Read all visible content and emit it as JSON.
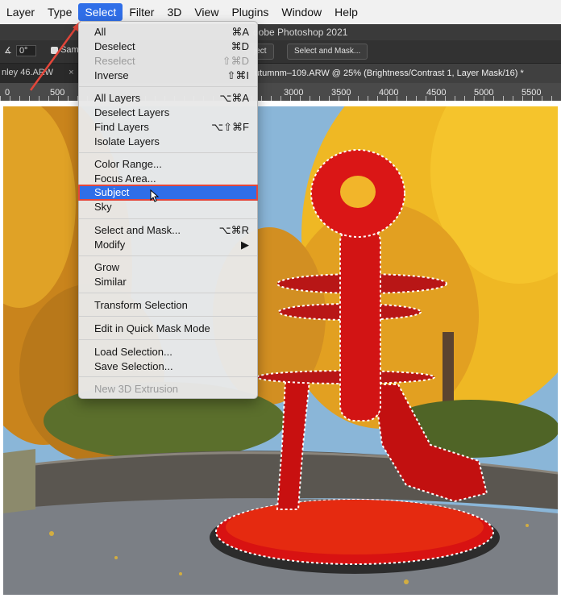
{
  "menubar": {
    "items": [
      "Layer",
      "Type",
      "Select",
      "Filter",
      "3D",
      "View",
      "Plugins",
      "Window",
      "Help"
    ],
    "active_item": "Select"
  },
  "window": {
    "title": "dobe Photoshop 2021"
  },
  "options_bar": {
    "angle_value": "0°",
    "sample_label": "Sam",
    "subject_button": "ject",
    "select_and_mask_button": "Select and Mask..."
  },
  "tabs": {
    "tab1": "nley 46.ARW",
    "tab1_close": "×",
    "tab2": "utumnm–109.ARW @ 25% (Brightness/Contrast 1, Layer Mask/16) *"
  },
  "ruler": {
    "labels": [
      "0",
      "500",
      "3000",
      "3500",
      "4000",
      "4500",
      "5000",
      "5500"
    ]
  },
  "select_menu": {
    "items": [
      {
        "label": "All",
        "shortcut": "⌘A"
      },
      {
        "label": "Deselect",
        "shortcut": "⌘D"
      },
      {
        "label": "Reselect",
        "shortcut": "⇧⌘D",
        "disabled": true
      },
      {
        "label": "Inverse",
        "shortcut": "⇧⌘I"
      },
      {
        "label": "All Layers",
        "shortcut": "⌥⌘A"
      },
      {
        "label": "Deselect Layers",
        "shortcut": ""
      },
      {
        "label": "Find Layers",
        "shortcut": "⌥⇧⌘F"
      },
      {
        "label": "Isolate Layers",
        "shortcut": ""
      },
      {
        "label": "Color Range...",
        "shortcut": ""
      },
      {
        "label": "Focus Area...",
        "shortcut": ""
      },
      {
        "label": "Subject",
        "shortcut": "",
        "highlighted": true
      },
      {
        "label": "Sky",
        "shortcut": ""
      },
      {
        "label": "Select and Mask...",
        "shortcut": "⌥⌘R"
      },
      {
        "label": "Modify",
        "shortcut": "▶"
      },
      {
        "label": "Grow",
        "shortcut": ""
      },
      {
        "label": "Similar",
        "shortcut": ""
      },
      {
        "label": "Transform Selection",
        "shortcut": ""
      },
      {
        "label": "Edit in Quick Mask Mode",
        "shortcut": ""
      },
      {
        "label": "Load Selection...",
        "shortcut": ""
      },
      {
        "label": "Save Selection...",
        "shortcut": ""
      },
      {
        "label": "New 3D Extrusion",
        "shortcut": "",
        "disabled": true
      }
    ]
  },
  "colors": {
    "menu_highlight": "#2f6ee8",
    "callout_red": "#e4463a",
    "sculpture_red": "#d81212"
  },
  "icons": {
    "pointer": "pointer-cursor-icon",
    "annotation": "red-arrow-annotation-icon"
  }
}
